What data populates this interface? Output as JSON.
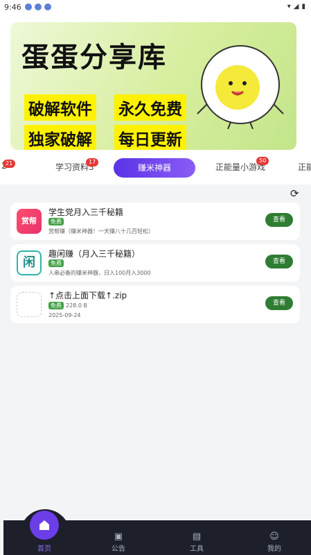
{
  "status": {
    "time": "9:46",
    "battery": "▮"
  },
  "banner": {
    "title": "蛋蛋分享库",
    "tags": [
      "破解软件",
      "永久免费",
      "独家破解",
      "每日更新"
    ]
  },
  "tabs": [
    {
      "label": "2",
      "badge": "21"
    },
    {
      "label": "学习资料3",
      "badge": "17"
    },
    {
      "label": "赚米神器",
      "badge": ""
    },
    {
      "label": "正能量小游戏",
      "badge": "50"
    },
    {
      "label": "正能",
      "badge": ""
    }
  ],
  "items": [
    {
      "title": "学生党月入三千秘籍",
      "free": "免费",
      "desc": "赏帮赚（赚米神器！一天赚八十几百轻松）",
      "button": "查看",
      "icon_text": "赏帮"
    },
    {
      "title": "趣闲赚（月入三千秘籍）",
      "free": "免费",
      "desc": "人串必备的赚米神器，日入100月入3000",
      "button": "查看",
      "icon_text": "闲"
    },
    {
      "title": "↑点击上面下载↑.zip",
      "free": "免费",
      "desc": "228.0 B",
      "date": "2025-09-24",
      "button": "查看"
    }
  ],
  "nav": [
    {
      "label": "首页",
      "icon": "home-icon"
    },
    {
      "label": "公告",
      "icon": "announcement-icon"
    },
    {
      "label": "工具",
      "icon": "toolbox-icon"
    },
    {
      "label": "我的",
      "icon": "profile-icon"
    }
  ],
  "colors": {
    "accent": "#6c3ee8",
    "free_green": "#43a047",
    "button_green": "#2e7d32",
    "badge_red": "#e53935",
    "navbar": "#1d1f2a"
  }
}
